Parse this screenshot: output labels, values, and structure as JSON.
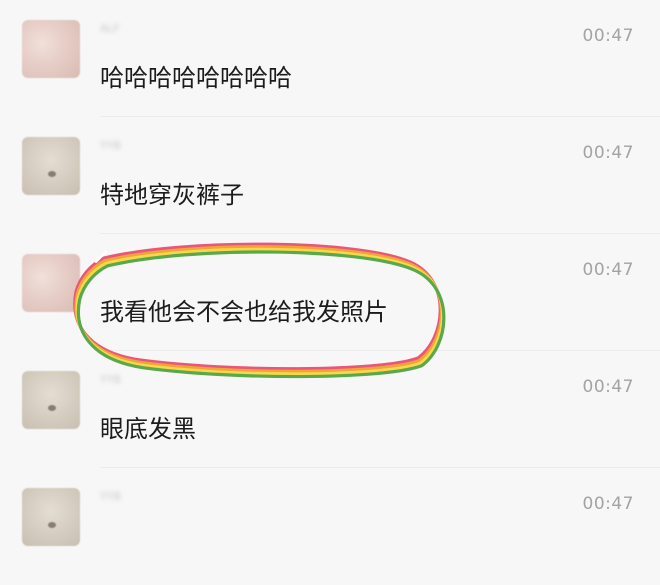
{
  "messages": [
    {
      "avatar": "pink",
      "nickname": "ALF",
      "time": "00:47",
      "text": "哈哈哈哈哈哈哈哈"
    },
    {
      "avatar": "gray",
      "nickname": "YYB",
      "time": "00:47",
      "text": "特地穿灰裤子"
    },
    {
      "avatar": "pink",
      "nickname": "ALF",
      "time": "00:47",
      "text": "我看他会不会也给我发照片",
      "highlighted": true
    },
    {
      "avatar": "gray",
      "nickname": "YYB",
      "time": "00:47",
      "text": "眼底发黑"
    },
    {
      "avatar": "gray",
      "nickname": "YYB",
      "time": "00:47",
      "text": ""
    }
  ],
  "highlight_colors": [
    "#e8577a",
    "#f2a33a",
    "#f5d94a",
    "#5aa84c"
  ]
}
